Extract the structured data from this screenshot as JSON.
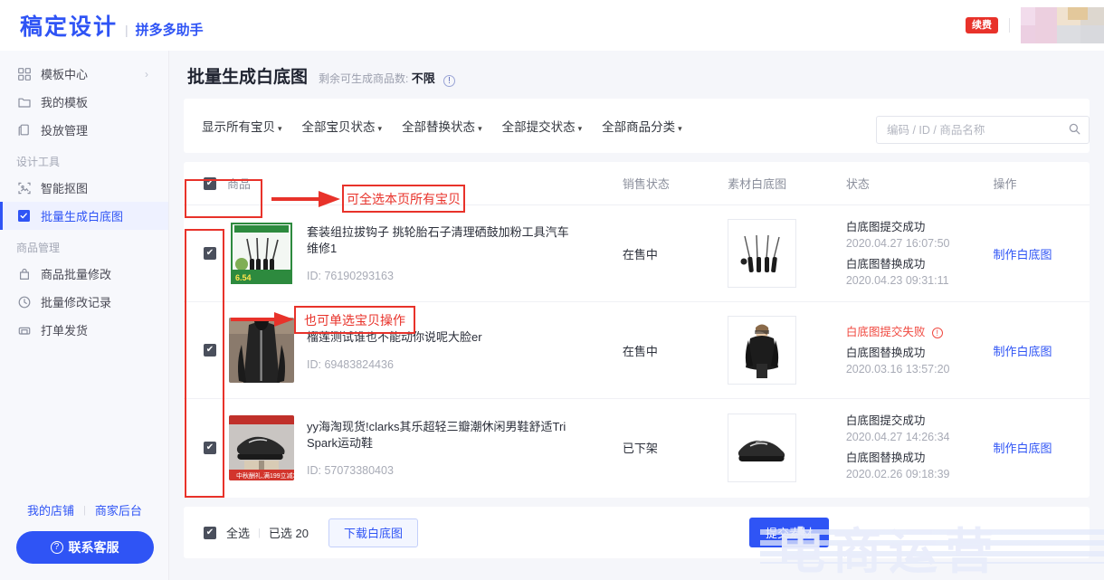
{
  "topbar": {
    "brand_name": "稿定设计",
    "brand_separator": "|",
    "brand_sub": "拼多多助手",
    "renew_label": "续费"
  },
  "sidebar": {
    "items": [
      {
        "label": "模板中心",
        "icon": "grid-icon",
        "chevron": "›"
      },
      {
        "label": "我的模板",
        "icon": "folder-icon"
      },
      {
        "label": "投放管理",
        "icon": "copy-icon"
      }
    ],
    "group_design": "设计工具",
    "design_items": [
      {
        "label": "智能抠图",
        "icon": "cutout-icon"
      },
      {
        "label": "批量生成白底图",
        "icon": "batch-image-icon"
      }
    ],
    "group_goods": "商品管理",
    "goods_items": [
      {
        "label": "商品批量修改",
        "icon": "bag-icon"
      },
      {
        "label": "批量修改记录",
        "icon": "clock-icon"
      },
      {
        "label": "打单发货",
        "icon": "printer-icon"
      }
    ],
    "my_shop": "我的店铺",
    "shop_divider": "|",
    "merchant_backend": "商家后台",
    "support_button": "联系客服",
    "support_icon": "question-circle-icon"
  },
  "page": {
    "title": "批量生成白底图",
    "subtitle_prefix": "剩余可生成商品数:",
    "subtitle_value": "不限",
    "info_icon": "info-circle-icon"
  },
  "search": {
    "placeholder": "编码 / ID / 商品名称",
    "value": "",
    "icon": "search-icon"
  },
  "filters": [
    {
      "label": "显示所有宝贝",
      "caret": "▾"
    },
    {
      "label": "全部宝贝状态",
      "caret": "▾"
    },
    {
      "label": "全部替换状态",
      "caret": "▾"
    },
    {
      "label": "全部提交状态",
      "caret": "▾"
    },
    {
      "label": "全部商品分类",
      "caret": "▾"
    }
  ],
  "table": {
    "header": {
      "product": "商品",
      "sale_status": "销售状态",
      "material_white_bg": "素材白底图",
      "status": "状态",
      "action": "操作",
      "checkbox_checked": true,
      "check_glyph": "✔"
    },
    "rows": [
      {
        "checked": true,
        "name": "套装组拉拔钩子 挑轮胎石子清理硒鼓加粉工具汽车维修1",
        "id": "ID: 76190293163",
        "sale_status": "在售中",
        "thumb": "wrench-tools-thumb",
        "material_thumb": "wrench-tools-white-bg",
        "status_lines": [
          {
            "text": "白底图提交成功",
            "type": "ok"
          },
          {
            "text": "2020.04.27 16:07:50",
            "type": "time"
          },
          {
            "text": "白底图替换成功",
            "type": "ok"
          },
          {
            "text": "2020.04.23 09:31:11",
            "type": "time"
          }
        ],
        "action": "制作白底图"
      },
      {
        "checked": true,
        "name": "榴莲测试谁也不能动你说呢大脸er",
        "id": "ID: 69483824436",
        "sale_status": "在售中",
        "thumb": "black-coat-thumb",
        "material_thumb": "black-coat-white-bg",
        "status_lines": [
          {
            "text": "白底图提交失败",
            "type": "fail",
            "icon": "warning-circle-icon"
          },
          {
            "text": "白底图替换成功",
            "type": "ok"
          },
          {
            "text": "2020.03.16 13:57:20",
            "type": "time"
          }
        ],
        "action": "制作白底图"
      },
      {
        "checked": true,
        "name": "yy海淘现货!clarks其乐超轻三瓣潮休闲男鞋舒适Tri Spark运动鞋",
        "id": "ID: 57073380403",
        "sale_status": "已下架",
        "thumb": "black-sneaker-thumb",
        "material_thumb": "black-sneaker-white-bg",
        "status_lines": [
          {
            "text": "白底图提交成功",
            "type": "ok"
          },
          {
            "text": "2020.04.27 14:26:34",
            "type": "time"
          },
          {
            "text": "白底图替换成功",
            "type": "ok"
          },
          {
            "text": "2020.02.26 09:18:39",
            "type": "time"
          }
        ],
        "action": "制作白底图"
      }
    ]
  },
  "bottombar": {
    "select_all": "全选",
    "divider": "|",
    "selected_count": "已选 20",
    "download_button": "下载白底图",
    "submit_button": "提交素材",
    "checkbox_checked": true,
    "check_glyph": "✔"
  },
  "annotations": [
    {
      "text": "可全选本页所有宝贝",
      "color": "#e8322a"
    },
    {
      "text": "也可单选宝贝操作",
      "color": "#e8322a"
    }
  ],
  "watermark": {
    "text": "电商运营"
  },
  "colors": {
    "brand_blue": "#2f54f5",
    "annotation_red": "#e8322a",
    "fail_red": "#f04a41",
    "page_bg": "#f5f6fa",
    "sidebar_bg": "#f7f8fc"
  }
}
